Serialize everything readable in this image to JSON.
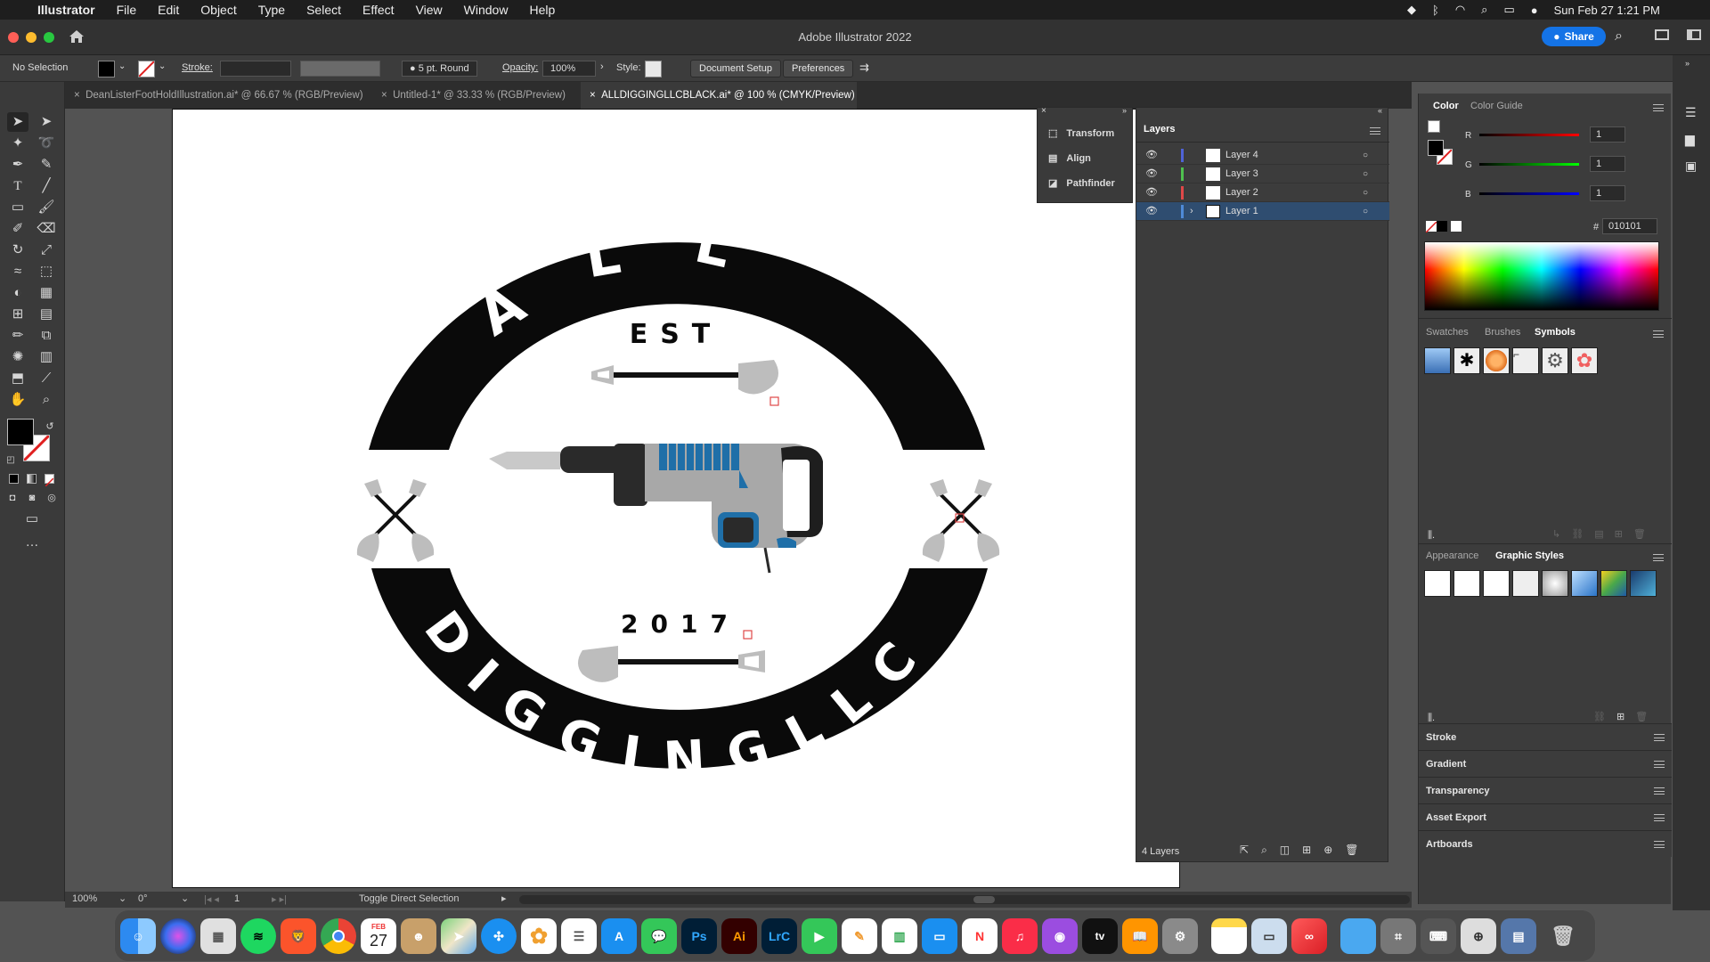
{
  "menubar": {
    "app_name": "Illustrator",
    "menus": [
      "File",
      "Edit",
      "Object",
      "Type",
      "Select",
      "Effect",
      "View",
      "Window",
      "Help"
    ],
    "datetime": "Sun Feb 27  1:21 PM"
  },
  "titlebar": {
    "title": "Adobe Illustrator 2022",
    "share_label": "Share"
  },
  "control_bar": {
    "selection": "No Selection",
    "stroke_label": "Stroke:",
    "brush": "5 pt. Round",
    "opacity_label": "Opacity:",
    "opacity_value": "100%",
    "style_label": "Style:",
    "document_setup": "Document Setup",
    "preferences": "Preferences"
  },
  "tabs": [
    {
      "label": "DeanListerFootHoldIllustration.ai* @ 66.67 % (RGB/Preview)"
    },
    {
      "label": "Untitled-1* @ 33.33 % (RGB/Preview)"
    },
    {
      "label": "ALLDIGGINGLLCBLACK.ai* @ 100 % (CMYK/Preview)"
    }
  ],
  "logo": {
    "top_text": "ALL",
    "est": "EST",
    "year": "2017",
    "bottom_text": "DIGGINGLLC"
  },
  "status": {
    "zoom": "100%",
    "rotation": "0°",
    "artboard": "1",
    "tool_hint": "Toggle Direct Selection"
  },
  "floating_panel": {
    "items": [
      "Transform",
      "Align",
      "Pathfinder"
    ]
  },
  "layers_panel": {
    "title": "Layers",
    "layers": [
      {
        "name": "Layer 4",
        "color": "#4f63d7"
      },
      {
        "name": "Layer 3",
        "color": "#4fc14f"
      },
      {
        "name": "Layer 2",
        "color": "#e04848"
      },
      {
        "name": "Layer 1",
        "color": "#4f8ad7"
      }
    ],
    "count": "4 Layers"
  },
  "color_panel": {
    "tabs": [
      "Color",
      "Color Guide"
    ],
    "r_label": "R",
    "r_value": "1",
    "g_label": "G",
    "g_value": "1",
    "b_label": "B",
    "b_value": "1",
    "hash": "#",
    "hex": "010101"
  },
  "symbols_panel": {
    "tabs": [
      "Swatches",
      "Brushes",
      "Symbols"
    ]
  },
  "styles_panel": {
    "tabs": [
      "Appearance",
      "Graphic Styles"
    ]
  },
  "collapsed_panels": [
    "Stroke",
    "Gradient",
    "Transparency",
    "Asset Export",
    "Artboards"
  ],
  "dock": {
    "calendar_month": "FEB",
    "calendar_day": "27",
    "apps": [
      "Finder",
      "Siri",
      "Launchpad",
      "Spotify",
      "Brave",
      "Chrome",
      "Calendar",
      "Contacts",
      "Maps",
      "Safari",
      "Photos",
      "Reminders",
      "App Store",
      "Messages",
      "Ps",
      "Ai",
      "LrC",
      "FaceTime",
      "Pages",
      "Numbers",
      "Keynote",
      "News",
      "Music",
      "Podcasts",
      "tv",
      "Books",
      "System Preferences",
      "Notes",
      "Preview",
      "Creative Cloud",
      "Folder",
      "Screenshot",
      "Keyboard",
      "Maps2",
      "Utility",
      "Trash"
    ]
  }
}
